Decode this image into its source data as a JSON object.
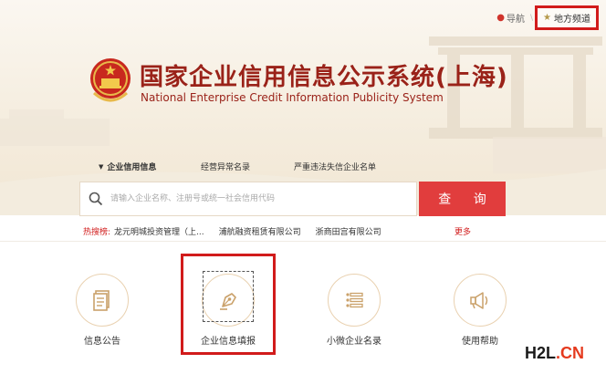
{
  "topnav": {
    "nav_label": "导航",
    "local_channel_label": "地方频道"
  },
  "header": {
    "title_zh": "国家企业信用信息公示系统(上海)",
    "title_en": "National Enterprise Credit Information Publicity System"
  },
  "tabs": [
    {
      "label": "企业信用信息",
      "active": true
    },
    {
      "label": "经营异常名录",
      "active": false
    },
    {
      "label": "严重违法失信企业名单",
      "active": false
    }
  ],
  "search": {
    "placeholder": "请输入企业名称、注册号或统一社会信用代码",
    "button_label": "查 询"
  },
  "hot_search": {
    "label": "热搜榜:",
    "items": [
      "龙元明城投资管理（上...",
      "浦航融资租赁有限公司",
      "浙商田宫有限公司"
    ],
    "more_label": "更多"
  },
  "functions": [
    {
      "label": "信息公告",
      "icon": "document-icon"
    },
    {
      "label": "企业信息填报",
      "icon": "pen-nib-icon"
    },
    {
      "label": "小微企业名录",
      "icon": "list-icon"
    },
    {
      "label": "使用帮助",
      "icon": "megaphone-icon"
    }
  ],
  "watermark": {
    "part1": "H2L",
    "part2": ".CN"
  },
  "colors": {
    "brand_red": "#9a2219",
    "button_red": "#e13d3d",
    "highlight_red": "#d11b1b",
    "icon_gold": "#caa16a"
  }
}
